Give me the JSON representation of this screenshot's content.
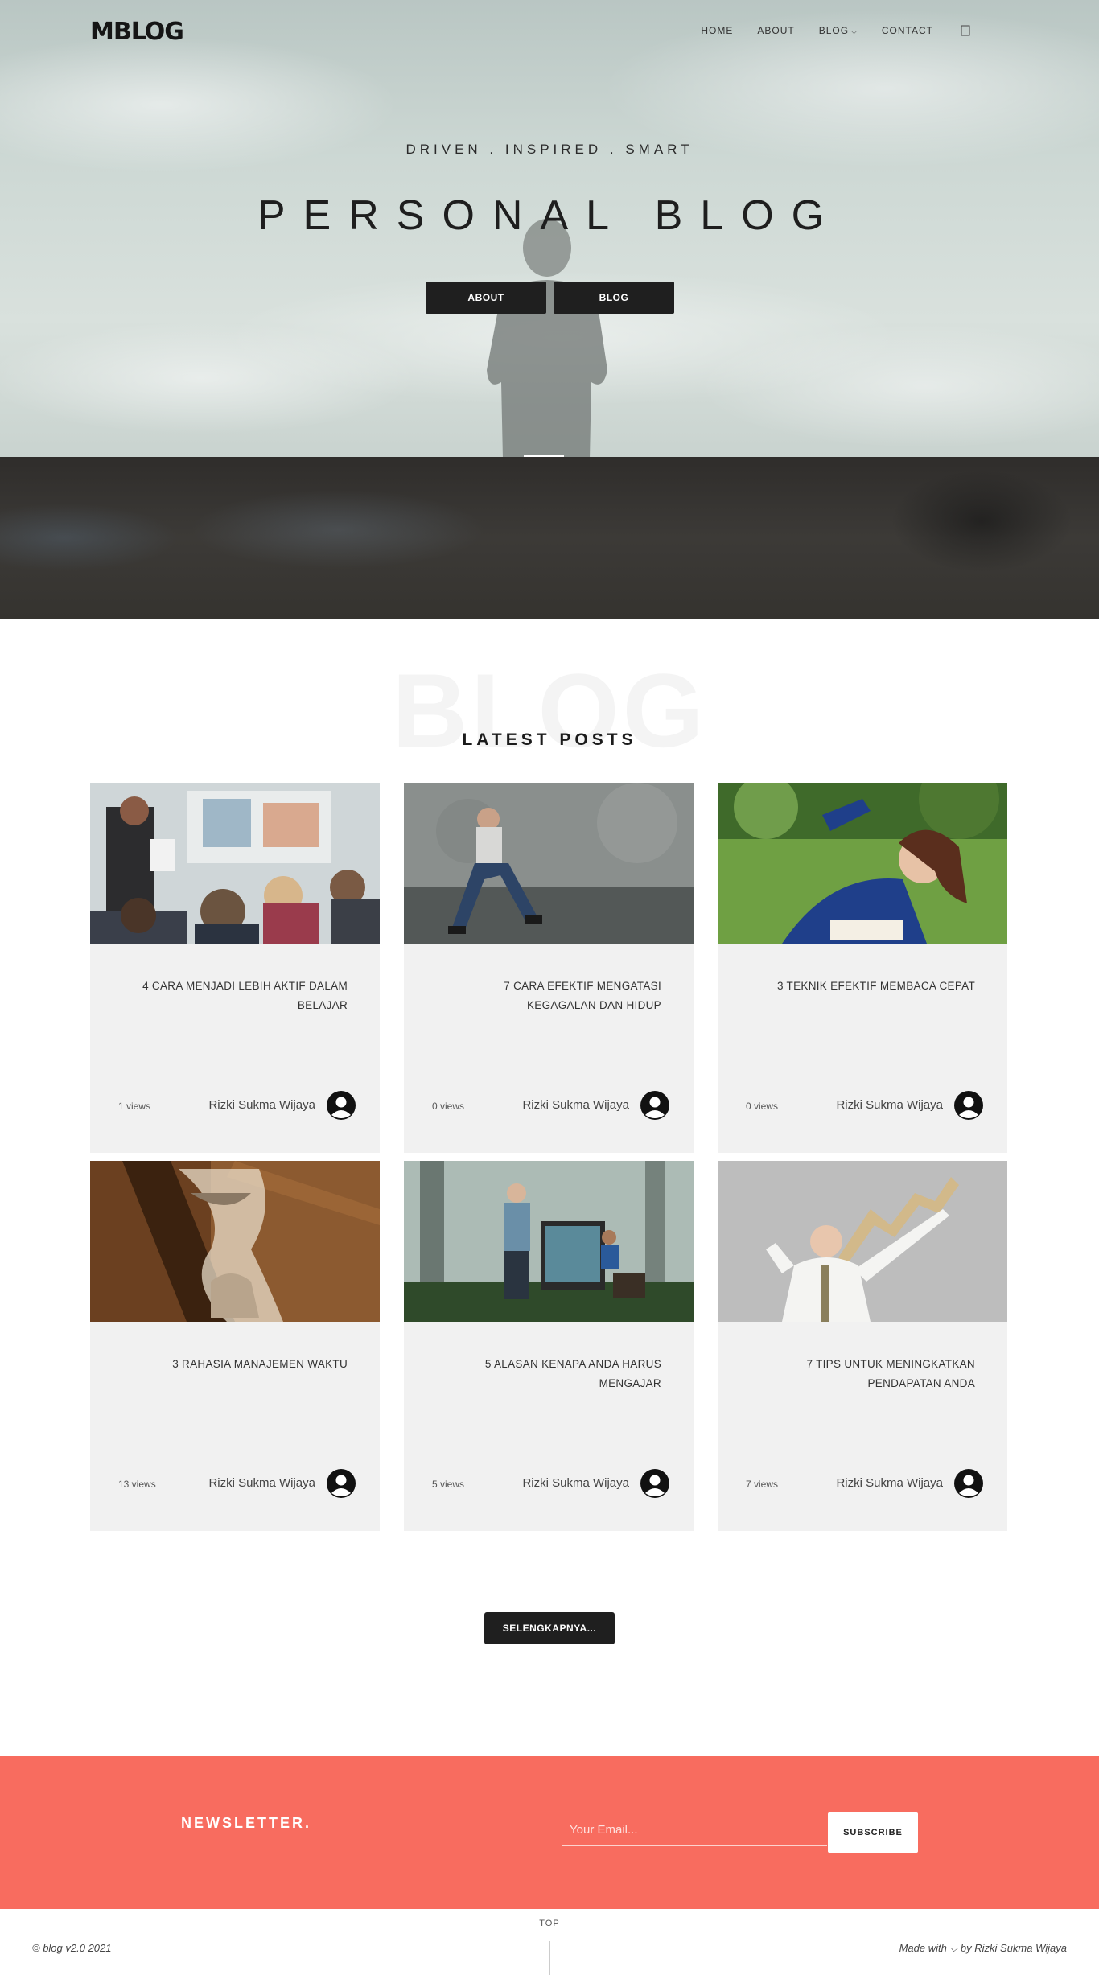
{
  "nav": {
    "logo": "MBLOG",
    "items": [
      "HOME",
      "ABOUT",
      "BLOG",
      "CONTACT"
    ],
    "blog_caret": "⌵"
  },
  "hero": {
    "tagline": "DRIVEN . INSPIRED . SMART",
    "title": "PERSONAL BLOG",
    "buttons": [
      "ABOUT",
      "BLOG"
    ]
  },
  "posts_section": {
    "ghost_text": "BLOG",
    "title": "LATEST POSTS",
    "posts": [
      {
        "title": "4 CARA MENJADI LEBIH AKTIF DALAM BELAJAR",
        "views": "1 views",
        "author": "Rizki Sukma Wijaya",
        "image": "classroom-photo"
      },
      {
        "title": "7 CARA EFEKTIF MENGATASI KEGAGALAN DAN HIDUP",
        "views": "0 views",
        "author": "Rizki Sukma Wijaya",
        "image": "sad-person-photo"
      },
      {
        "title": "3 TEKNIK EFEKTIF MEMBACA CEPAT",
        "views": "0 views",
        "author": "Rizki Sukma Wijaya",
        "image": "girl-reading-photo"
      },
      {
        "title": "3 RAHASIA MANAJEMEN WAKTU",
        "views": "13 views",
        "author": "Rizki Sukma Wijaya",
        "image": "hourglass-photo"
      },
      {
        "title": "5 ALASAN KENAPA ANDA HARUS MENGAJAR",
        "views": "5 views",
        "author": "Rizki Sukma Wijaya",
        "image": "teacher-forest-photo"
      },
      {
        "title": "7 TIPS UNTUK MENINGKATKAN PENDAPATAN ANDA",
        "views": "7 views",
        "author": "Rizki Sukma Wijaya",
        "image": "businessman-growth-photo"
      }
    ],
    "more_label": "SELENGKAPNYA..."
  },
  "newsletter": {
    "title": "NEWSLETTER.",
    "placeholder": "Your Email...",
    "button": "SUBSCRIBE"
  },
  "footer": {
    "copyright": "© blog v2.0 2021",
    "top": "TOP",
    "made_with": "Made with ⌵ by Rizki Sukma Wijaya"
  },
  "colors": {
    "accent": "#f86c5f",
    "dark_button": "#1f1f1f",
    "card_bg": "#f1f1f1"
  }
}
